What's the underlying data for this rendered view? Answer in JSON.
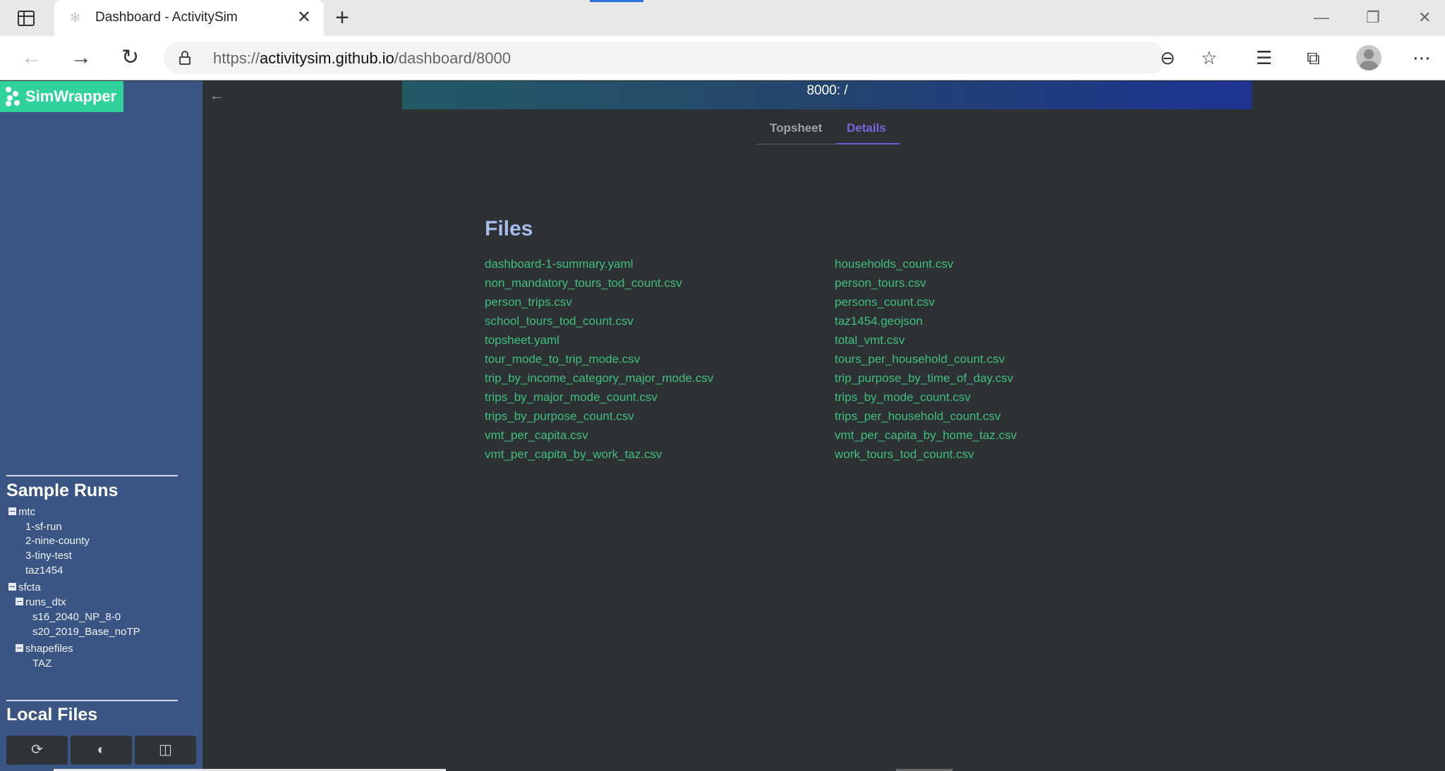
{
  "browser": {
    "tab_title": "Dashboard - ActivitySim",
    "url_scheme": "https://",
    "url_host": "activitysim.github.io",
    "url_path": "/dashboard/8000"
  },
  "app": {
    "logo_text": "SimWrapper",
    "banner_text": "8000: /",
    "tabs": [
      {
        "label": "Topsheet",
        "active": false
      },
      {
        "label": "Details",
        "active": true
      }
    ],
    "colors": {
      "sidebar": "#3a5584",
      "logo": "#2fd39a",
      "active_tab": "#6f5ad8",
      "link": "#3fbf7f",
      "heading": "#a5bdea"
    }
  },
  "sidebar": {
    "sample_runs_heading": "Sample Runs",
    "local_files_heading": "Local Files",
    "tree": [
      {
        "label": "mtc",
        "toggle": true
      },
      {
        "label": "1-sf-run"
      },
      {
        "label": "2-nine-county"
      },
      {
        "label": "3-tiny-test"
      },
      {
        "label": "taz1454"
      },
      {
        "label": "sfcta",
        "toggle": true
      },
      {
        "label": "runs_dtx",
        "toggle": true
      },
      {
        "label": "s16_2040_NP_8-0"
      },
      {
        "label": "s20_2019_Base_noTP"
      },
      {
        "label": "shapefiles",
        "toggle": true
      },
      {
        "label": "TAZ"
      }
    ],
    "buttons": [
      "refresh-icon",
      "contrast-icon",
      "split-view-icon"
    ]
  },
  "files": {
    "title": "Files",
    "left": [
      "dashboard-1-summary.yaml",
      "non_mandatory_tours_tod_count.csv",
      "person_trips.csv",
      "school_tours_tod_count.csv",
      "topsheet.yaml",
      "tour_mode_to_trip_mode.csv",
      "trip_by_income_category_major_mode.csv",
      "trips_by_major_mode_count.csv",
      "trips_by_purpose_count.csv",
      "vmt_per_capita.csv",
      "vmt_per_capita_by_work_taz.csv"
    ],
    "right": [
      "households_count.csv",
      "person_tours.csv",
      "persons_count.csv",
      "taz1454.geojson",
      "total_vmt.csv",
      "tours_per_household_count.csv",
      "trip_purpose_by_time_of_day.csv",
      "trips_by_mode_count.csv",
      "trips_per_household_count.csv",
      "vmt_per_capita_by_home_taz.csv",
      "work_tours_tod_count.csv"
    ]
  }
}
